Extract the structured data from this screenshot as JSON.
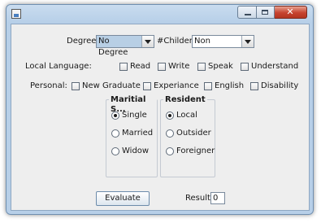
{
  "form": {
    "degree_label": "Degree",
    "degree_value": "No Degree",
    "childer_label": "#Childer",
    "childer_value": "Non",
    "local_language_label": "Local Language:",
    "local_language_options": [
      "Read",
      "Write",
      "Speak",
      "Understand"
    ],
    "personal_label": "Personal:",
    "personal_options": [
      "New Graduate",
      "Experiance",
      "English",
      "Disability"
    ],
    "marital_status": {
      "title": "Maritial S...",
      "options": [
        "Single",
        "Married",
        "Widow"
      ],
      "selected": "Single"
    },
    "resident": {
      "title": "Resident",
      "options": [
        "Local",
        "Outsider",
        "Foreigner"
      ],
      "selected": "Local"
    },
    "evaluate_label": "Evaluate",
    "result_label": "Result",
    "result_value": "0"
  },
  "window": {
    "close_glyph": "✕"
  }
}
